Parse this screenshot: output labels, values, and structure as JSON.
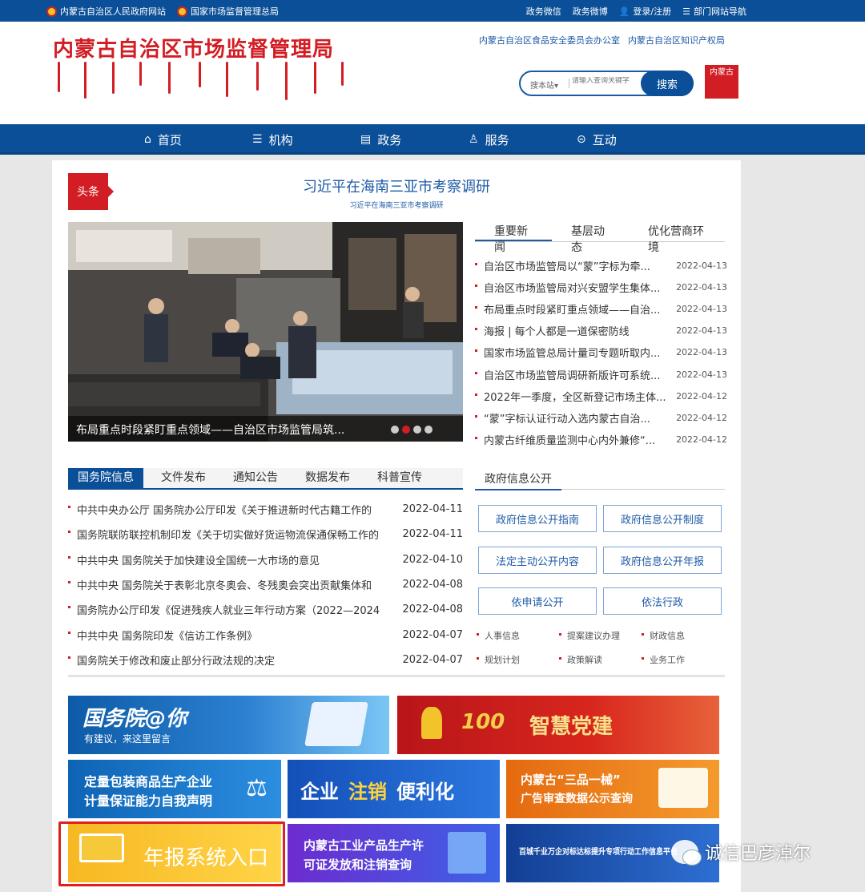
{
  "topbar": {
    "left_links": [
      "内蒙古自治区人民政府网站",
      "国家市场监督管理总局"
    ],
    "right_links": [
      "政务微信",
      "政务微博",
      "登录/注册",
      "部门网站导航"
    ]
  },
  "header": {
    "site_title": "内蒙古自治区市场监督管理局",
    "related_links": [
      "内蒙古自治区食品安全委员会办公室",
      "内蒙古自治区知识产权局"
    ],
    "search": {
      "scope": "搜本站▾",
      "placeholder": "请输入查询关键字",
      "button": "搜索"
    },
    "seal_text": "内蒙古"
  },
  "nav": {
    "items": [
      {
        "label": "首页",
        "icon": "home-icon"
      },
      {
        "label": "机构",
        "icon": "list-icon"
      },
      {
        "label": "政务",
        "icon": "folder-icon"
      },
      {
        "label": "服务",
        "icon": "service-icon"
      },
      {
        "label": "互动",
        "icon": "chat-icon"
      }
    ]
  },
  "headline": {
    "tag": "头条",
    "title": "习近平在海南三亚市考察调研",
    "subtitle": "习近平在海南三亚市考察调研"
  },
  "carousel": {
    "caption": "布局重点时段紧盯重点领域——自治区市场监管局筑..."
  },
  "news_tabs": [
    "重要新闻",
    "基层动态",
    "优化营商环境"
  ],
  "news": [
    {
      "title": "自治区市场监管局以“蒙”字标为牵...",
      "date": "2022-04-13"
    },
    {
      "title": "自治区市场监管局对兴安盟学生集体...",
      "date": "2022-04-13"
    },
    {
      "title": "布局重点时段紧盯重点领域——自治...",
      "date": "2022-04-13"
    },
    {
      "title": "海报 | 每个人都是一道保密防线",
      "date": "2022-04-13"
    },
    {
      "title": "国家市场监管总局计量司专题听取内...",
      "date": "2022-04-13"
    },
    {
      "title": "自治区市场监管局调研新版许可系统...",
      "date": "2022-04-13"
    },
    {
      "title": "2022年一季度，全区新登记市场主体...",
      "date": "2022-04-12"
    },
    {
      "title": "“蒙”字标认证行动入选内蒙古自治...",
      "date": "2022-04-12"
    },
    {
      "title": "内蒙古纤维质量监测中心内外兼修“...",
      "date": "2022-04-12"
    }
  ],
  "doc_tabs": [
    "国务院信息",
    "文件发布",
    "通知公告",
    "数据发布",
    "科普宣传"
  ],
  "docs": [
    {
      "title": "中共中央办公厅 国务院办公厅印发《关于推进新时代古籍工作的",
      "date": "2022-04-11"
    },
    {
      "title": "国务院联防联控机制印发《关于切实做好货运物流保通保畅工作的",
      "date": "2022-04-11"
    },
    {
      "title": "中共中央 国务院关于加快建设全国统一大市场的意见",
      "date": "2022-04-10"
    },
    {
      "title": "中共中央 国务院关于表彰北京冬奥会、冬残奥会突出贡献集体和",
      "date": "2022-04-08"
    },
    {
      "title": "国务院办公厅印发《促进残疾人就业三年行动方案（2022—2024",
      "date": "2022-04-08"
    },
    {
      "title": "中共中央 国务院印发《信访工作条例》",
      "date": "2022-04-07"
    },
    {
      "title": "国务院关于修改和废止部分行政法规的决定",
      "date": "2022-04-07"
    }
  ],
  "gov_info": {
    "title": "政府信息公开",
    "buttons": [
      "政府信息公开指南",
      "政府信息公开制度",
      "法定主动公开内容",
      "政府信息公开年报",
      "依申请公开",
      "依法行政"
    ],
    "small_links": [
      "人事信息",
      "提案建议办理",
      "财政信息",
      "规划计划",
      "政策解读",
      "业务工作"
    ]
  },
  "banners": {
    "b1": {
      "title": "国务院@你",
      "sub": "有建议，来这里留言"
    },
    "b2": {
      "badge": "100",
      "title": "智慧党建"
    },
    "b3": {
      "line1": "定量包装商品生产企业",
      "line2": "计量保证能力自我声明"
    },
    "b4": {
      "pre": "企业",
      "mid": "注销",
      "post": "便利化"
    },
    "b5": {
      "line1": "内蒙古“三品一械”",
      "line2": "广告审查数据公示查询"
    },
    "b6": {
      "title": "年报系统入口"
    },
    "b7": {
      "line1": "内蒙古工业产品生产许",
      "line2": "可证发放和注销查询"
    },
    "b8": {
      "title": "百城千业万企对标达标提升专项行动工作信息平台"
    }
  },
  "watermark": "诚信巴彦淖尔",
  "colors": {
    "primary": "#0b4f98",
    "accent": "#d21d24",
    "highlight_border": "#e02020"
  }
}
